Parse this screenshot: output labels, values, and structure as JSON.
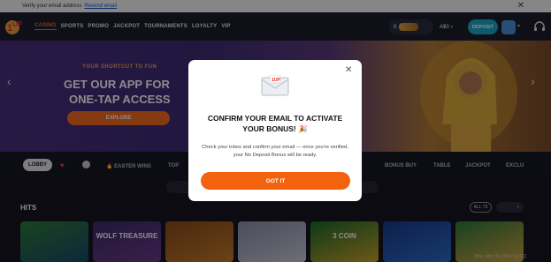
{
  "notice": {
    "text": "Verify your email address",
    "resend": "Resend email"
  },
  "header": {
    "nav": [
      "CASINO",
      "SPORTS",
      "PROMO",
      "JACKPOT",
      "TOURNAMENTS",
      "LOYALTY",
      "VIP"
    ],
    "balance": "0",
    "currency": "A$0",
    "deposit": "DEPOSIT"
  },
  "hero": {
    "subtitle": "YOUR SHORTCUT TO FUN",
    "title_line1": "GET OUR APP FOR",
    "title_line2": "ONE-TAP ACCESS",
    "button": "EXPLORE"
  },
  "categories": {
    "lobby": "LOBBY",
    "easter": "EASTER WINS",
    "top": "TOP",
    "bonus_buy": "BONUS BUY",
    "table": "TABLE",
    "jackpot": "JACKPOT",
    "exclusive": "EXCLU"
  },
  "hits": {
    "title": "HITS",
    "all": "ALL 73",
    "tiles": [
      "",
      "WOLF TREASURE",
      "",
      "",
      "3 COIN",
      "",
      ""
    ]
  },
  "timestamp": "Mon, Mar 30, 06:47 (UTC)",
  "modal": {
    "title": "CONFIRM YOUR EMAIL TO ACTIVATE YOUR BONUS! 🎉",
    "body": "Check your inbox and confirm your email — once you're verified, your No Deposit Bonus will be ready.",
    "button": "GOT IT"
  },
  "colors": {
    "accent": "#f26a21",
    "deposit": "#1aa6c9",
    "header": "#1d1c2c"
  }
}
